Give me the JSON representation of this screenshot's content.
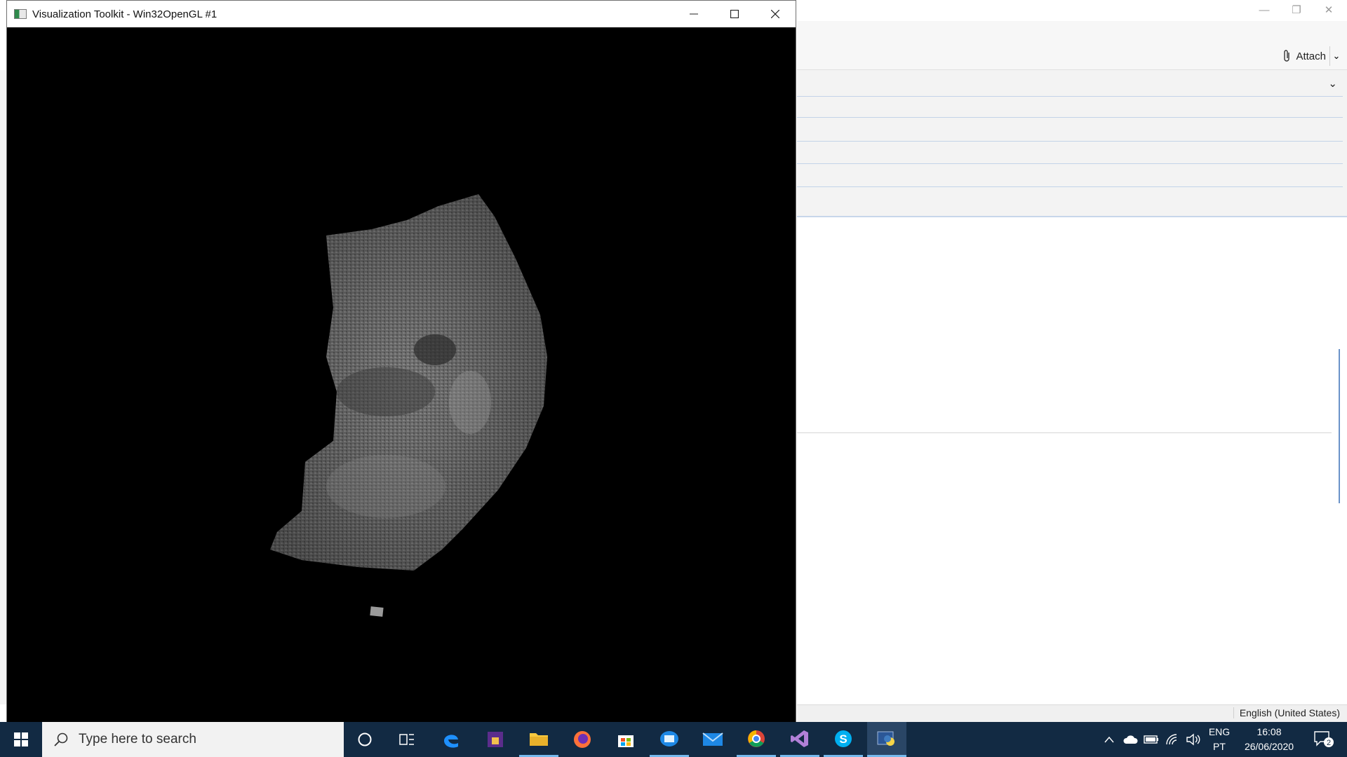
{
  "background_app": {
    "attach_label": "Attach",
    "language_status": "English (United States)"
  },
  "vtk_window": {
    "title": "Visualization Toolkit - Win32OpenGL #1"
  },
  "taskbar": {
    "search_placeholder": "Type here to search",
    "input_language": "ENG",
    "input_layout": "PT",
    "time": "16:08",
    "date": "26/06/2020",
    "notification_count": "2"
  },
  "colors": {
    "taskbar_bg": "#122a43",
    "mesh": "#7a7a7a",
    "viewport_bg": "#000000"
  }
}
